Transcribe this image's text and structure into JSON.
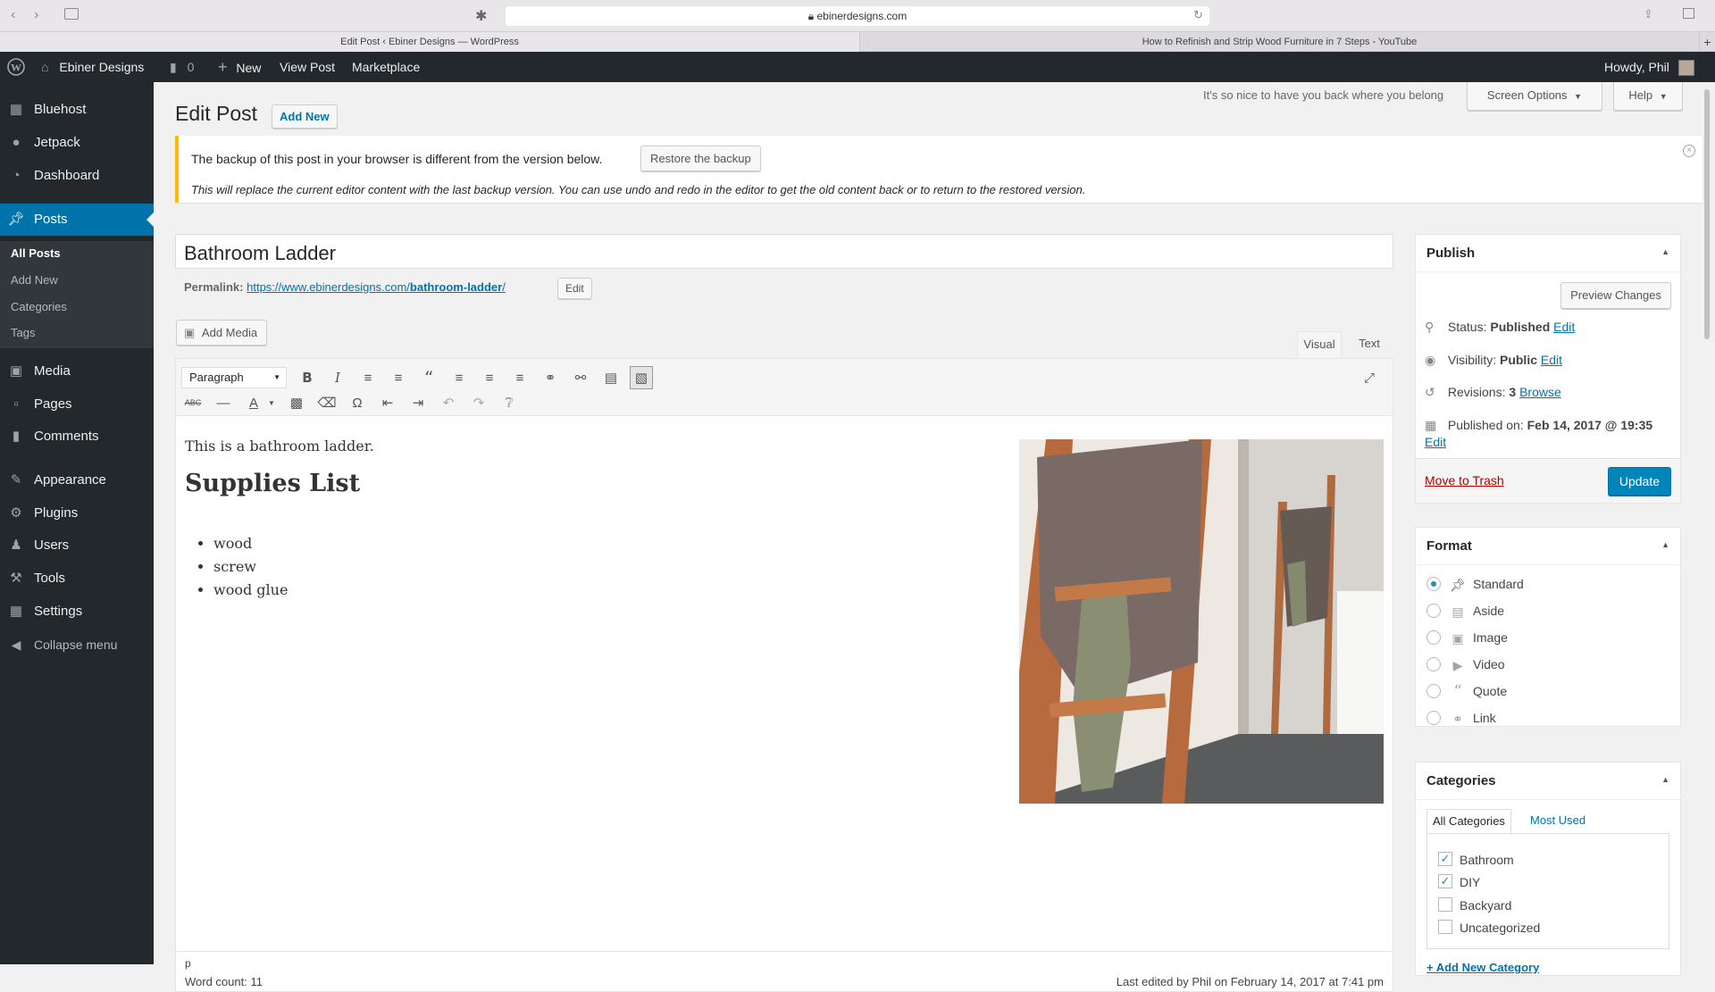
{
  "browser": {
    "url": "ebinerdesigns.com",
    "tabs": [
      {
        "title": "Edit Post ‹ Ebiner Designs — WordPress"
      },
      {
        "title": "How to Refinish and Strip Wood Furniture in 7 Steps - YouTube"
      }
    ]
  },
  "adminbar": {
    "site_name": "Ebiner Designs",
    "comments_count": "0",
    "new_label": "New",
    "view_post": "View Post",
    "marketplace": "Marketplace",
    "howdy": "Howdy, Phil"
  },
  "sidebar": {
    "items": [
      {
        "label": "Bluehost",
        "icon": "grid-icon"
      },
      {
        "label": "Jetpack",
        "icon": "jetpack-icon"
      },
      {
        "label": "Dashboard",
        "icon": "dashboard-icon"
      },
      {
        "label": "Posts",
        "icon": "pin-icon"
      },
      {
        "label": "Media",
        "icon": "media-icon"
      },
      {
        "label": "Pages",
        "icon": "pages-icon"
      },
      {
        "label": "Comments",
        "icon": "comments-icon"
      },
      {
        "label": "Appearance",
        "icon": "brush-icon"
      },
      {
        "label": "Plugins",
        "icon": "plugin-icon"
      },
      {
        "label": "Users",
        "icon": "users-icon"
      },
      {
        "label": "Tools",
        "icon": "wrench-icon"
      },
      {
        "label": "Settings",
        "icon": "settings-icon"
      },
      {
        "label": "Collapse menu",
        "icon": "collapse-icon"
      }
    ],
    "submenu": [
      "All Posts",
      "Add New",
      "Categories",
      "Tags"
    ],
    "active": "Posts",
    "active_color": "#0073aa"
  },
  "header": {
    "tagline": "It's so nice to have you back where you belong",
    "screen_options": "Screen Options",
    "help": "Help",
    "page_title": "Edit Post",
    "add_new": "Add New"
  },
  "notice": {
    "line1": "The backup of this post in your browser is different from the version below.",
    "restore_button": "Restore the backup",
    "line2": "This will replace the current editor content with the last backup version. You can use undo and redo in the editor to get the old content back or to return to the restored version."
  },
  "post": {
    "title": "Bathroom Ladder",
    "permalink_label": "Permalink:",
    "permalink_base": "https://www.ebinerdesigns.com/",
    "permalink_slug": "bathroom-ladder",
    "permalink_edit": "Edit",
    "add_media": "Add Media",
    "tab_visual": "Visual",
    "tab_text": "Text",
    "format_select": "Paragraph",
    "body_text": "This is a bathroom ladder.",
    "heading": "Supplies List",
    "list": [
      "wood",
      "screw",
      "wood glue"
    ],
    "path": "p",
    "word_count": "Word count: 11",
    "last_edited": "Last edited by Phil on February 14, 2017 at 7:41 pm"
  },
  "publish": {
    "title": "Publish",
    "preview_button": "Preview Changes",
    "status_label": "Status:",
    "status_value": "Published",
    "visibility_label": "Visibility:",
    "visibility_value": "Public",
    "revisions_label": "Revisions:",
    "revisions_value": "3",
    "browse": "Browse",
    "published_label": "Published on:",
    "published_value": "Feb 14, 2017 @ 19:35",
    "edit": "Edit",
    "trash": "Move to Trash",
    "update": "Update",
    "accent": "#0085ba"
  },
  "format": {
    "title": "Format",
    "options": [
      {
        "label": "Standard",
        "icon": "pin-icon",
        "selected": true
      },
      {
        "label": "Aside",
        "icon": "aside-icon",
        "selected": false
      },
      {
        "label": "Image",
        "icon": "image-icon",
        "selected": false
      },
      {
        "label": "Video",
        "icon": "video-icon",
        "selected": false
      },
      {
        "label": "Quote",
        "icon": "quote-icon",
        "selected": false
      },
      {
        "label": "Link",
        "icon": "link-icon",
        "selected": false
      }
    ]
  },
  "categories": {
    "title": "Categories",
    "tab_all": "All Categories",
    "tab_most": "Most Used",
    "items": [
      {
        "label": "Bathroom",
        "checked": true
      },
      {
        "label": "DIY",
        "checked": true
      },
      {
        "label": "Backyard",
        "checked": false
      },
      {
        "label": "Uncategorized",
        "checked": false
      }
    ],
    "add_new": "+ Add New Category"
  }
}
